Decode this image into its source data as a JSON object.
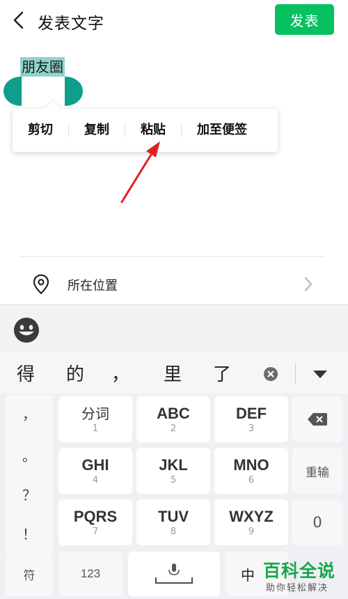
{
  "header": {
    "title": "发表文字",
    "publish_label": "发表"
  },
  "editor": {
    "selected_text": "朋友圈"
  },
  "context_menu": {
    "items": [
      "剪切",
      "复制",
      "粘贴",
      "加至便签"
    ]
  },
  "location": {
    "label": "所在位置"
  },
  "keyboard": {
    "candidates": [
      "得",
      "的",
      "，",
      "里",
      "了"
    ],
    "punctuation": [
      "，",
      "。",
      "？",
      "！"
    ],
    "rows": [
      [
        {
          "main": "分词",
          "sub": "1"
        },
        {
          "main": "ABC",
          "sub": "2"
        },
        {
          "main": "DEF",
          "sub": "3"
        }
      ],
      [
        {
          "main": "GHI",
          "sub": "4"
        },
        {
          "main": "JKL",
          "sub": "5"
        },
        {
          "main": "MNO",
          "sub": "6"
        }
      ],
      [
        {
          "main": "PQRS",
          "sub": "7"
        },
        {
          "main": "TUV",
          "sub": "8"
        },
        {
          "main": "WXYZ",
          "sub": "9"
        }
      ]
    ],
    "retype_label": "重输",
    "zero_label": "0",
    "symbol_label": "符",
    "num_label": "123",
    "lang_label": "中"
  },
  "watermark": {
    "main": "百科全说",
    "sub": "助你轻松解决"
  },
  "colors": {
    "accent": "#07c160",
    "selection": "#8fd4cc",
    "handle": "#0f9e8c",
    "annotation": "#e02020"
  }
}
